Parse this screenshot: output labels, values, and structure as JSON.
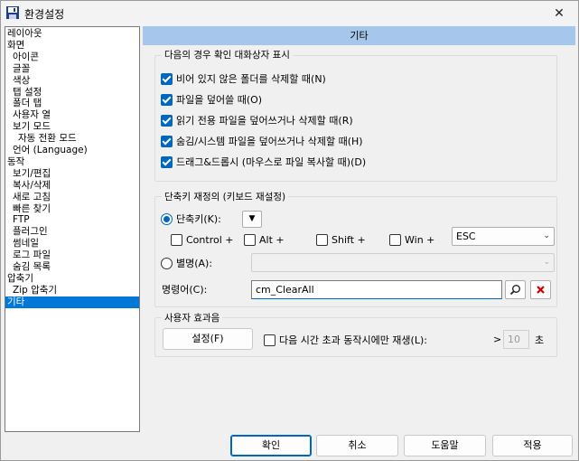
{
  "window": {
    "title": "환경설정",
    "close_glyph": "✕"
  },
  "tree": {
    "items": [
      {
        "label": "레이아웃",
        "indent": 0
      },
      {
        "label": "화면",
        "indent": 0
      },
      {
        "label": "아이콘",
        "indent": 1
      },
      {
        "label": "글꼴",
        "indent": 1
      },
      {
        "label": "색상",
        "indent": 1
      },
      {
        "label": "탭 설정",
        "indent": 1
      },
      {
        "label": "폴더 탭",
        "indent": 1
      },
      {
        "label": "사용자 열",
        "indent": 1
      },
      {
        "label": "보기 모드",
        "indent": 1
      },
      {
        "label": "자동 전환 모드",
        "indent": 2
      },
      {
        "label": "언어 (Language)",
        "indent": 1
      },
      {
        "label": "동작",
        "indent": 0
      },
      {
        "label": "보기/편집",
        "indent": 1
      },
      {
        "label": "복사/삭제",
        "indent": 1
      },
      {
        "label": "새로 고침",
        "indent": 1
      },
      {
        "label": "빠른 찾기",
        "indent": 1
      },
      {
        "label": "FTP",
        "indent": 1
      },
      {
        "label": "플러그인",
        "indent": 1
      },
      {
        "label": "썸네일",
        "indent": 1
      },
      {
        "label": "로그 파일",
        "indent": 1
      },
      {
        "label": "숨김 목록",
        "indent": 1
      },
      {
        "label": "압축기",
        "indent": 0
      },
      {
        "label": "Zip 압축기",
        "indent": 1
      },
      {
        "label": "기타",
        "indent": 0,
        "selected": true
      }
    ]
  },
  "section": {
    "title": "기타"
  },
  "confirm_group": {
    "title": "다음의 경우 확인 대화상자 표시",
    "items": [
      {
        "label": "비어 있지 않은 폴더를 삭제할 때(N)",
        "checked": true
      },
      {
        "label": "파일을 덮어쓸 때(O)",
        "checked": true
      },
      {
        "label": "읽기 전용 파일을 덮어쓰거나 삭제할 때(R)",
        "checked": true
      },
      {
        "label": "숨김/시스템 파일을 덮어쓰거나 삭제할 때(H)",
        "checked": true
      },
      {
        "label": "드래그&드롭시 (마우스로 파일 복사할 때)(D)",
        "checked": true
      }
    ]
  },
  "hotkey_group": {
    "title": "단축키 재정의 (키보드 재설정)",
    "shortcut_radio": {
      "label": "단축키(K):",
      "selected": true
    },
    "shortcut_dropdown_glyph": "▼",
    "modifiers": [
      {
        "label": "Control +",
        "checked": false
      },
      {
        "label": "Alt +",
        "checked": false
      },
      {
        "label": "Shift +",
        "checked": false
      },
      {
        "label": "Win +",
        "checked": false
      }
    ],
    "key_value": "ESC",
    "alias_radio": {
      "label": "별명(A):",
      "selected": false
    },
    "alias_value": "",
    "command_label": "명령어(C):",
    "command_value": "cm_ClearAll",
    "combo_arrow": "⌄"
  },
  "sound_group": {
    "title": "사용자 효과음",
    "settings_button": "설정(F)",
    "play_only_label": "다음 시간 초과 동작시에만 재생(L):",
    "play_only_checked": false,
    "gt_sign": ">",
    "seconds_value": "10",
    "seconds_unit": "초"
  },
  "buttons": {
    "ok": "확인",
    "cancel": "취소",
    "help": "도움말",
    "apply": "적용"
  },
  "colors": {
    "accent": "#0067c0",
    "selection": "#0078d7",
    "header_bg": "#a7c6ec",
    "clear_icon": "#d00000"
  }
}
